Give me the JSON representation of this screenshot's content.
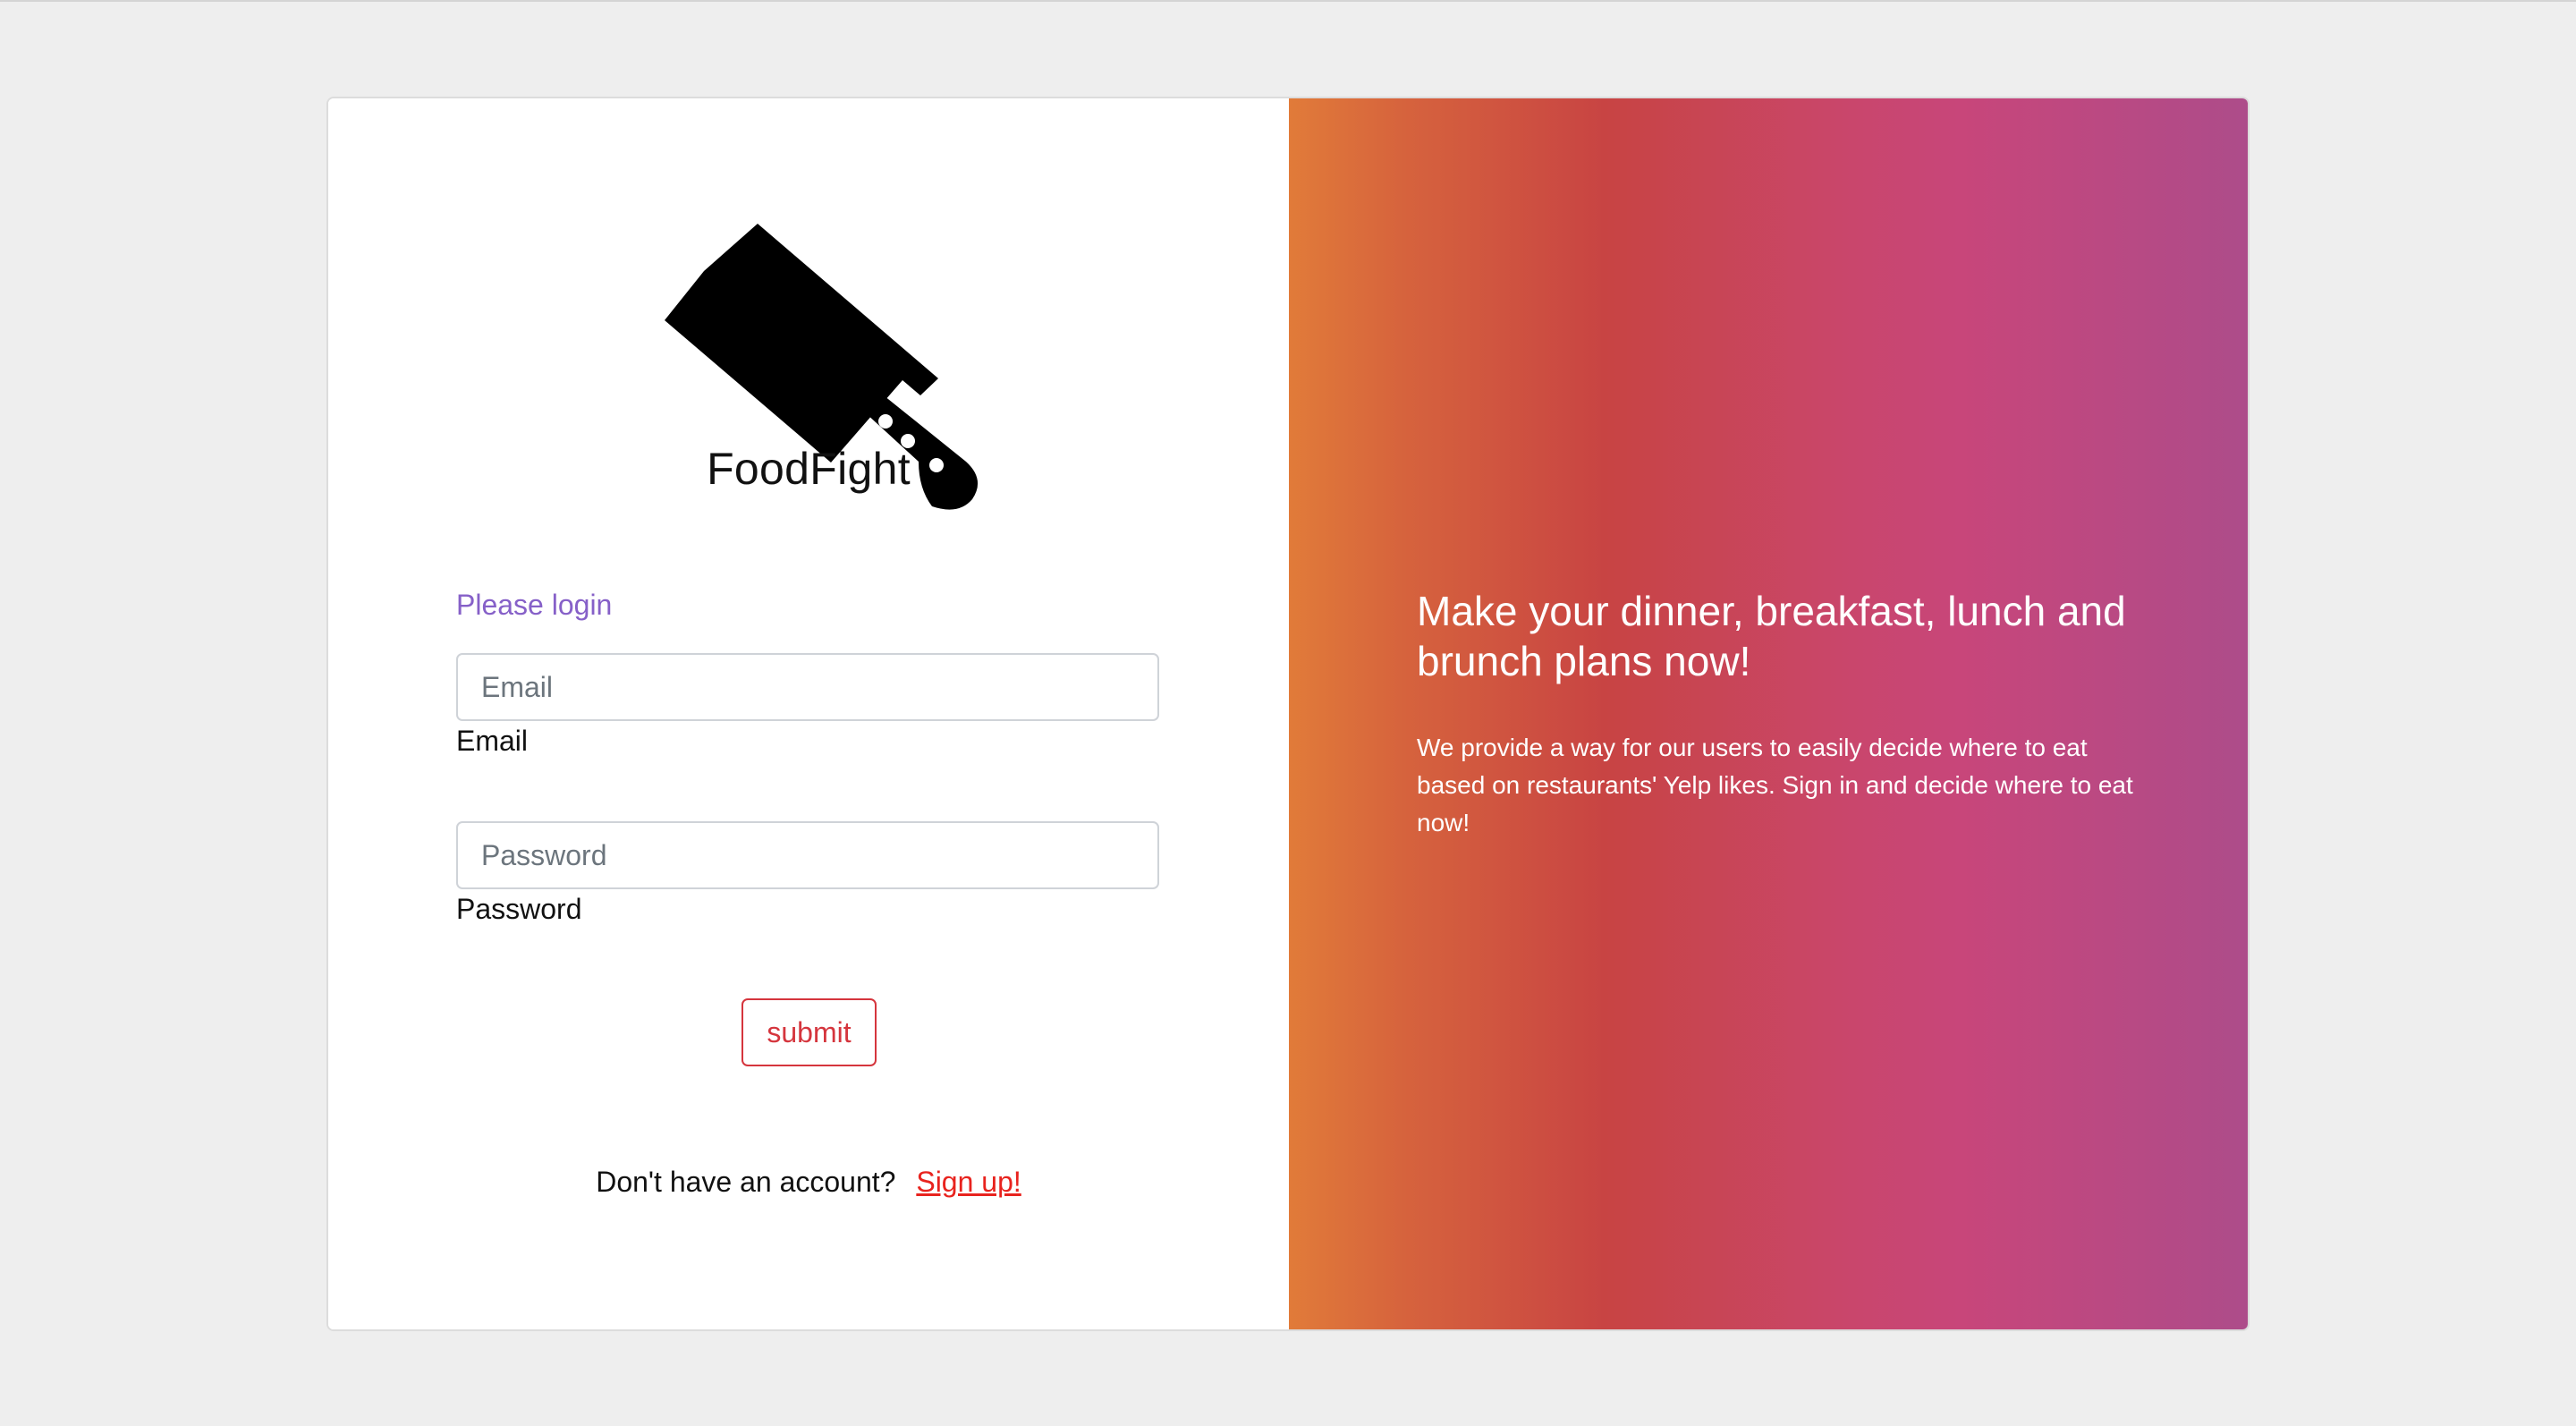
{
  "brand": {
    "name": "FoodFight",
    "logo_icon": "cleaver-knife-icon"
  },
  "login": {
    "heading": "Please login",
    "email": {
      "placeholder": "Email",
      "value": "",
      "label": "Email"
    },
    "password": {
      "placeholder": "Password",
      "value": "",
      "label": "Password"
    },
    "submit_label": "submit",
    "signup_prompt": "Don't have an account?",
    "signup_link": "Sign up!"
  },
  "promo": {
    "title": "Make your dinner, breakfast, lunch and brunch plans now!",
    "text": "We provide a way for our users to easily decide where to eat based on restaurants' Yelp likes. Sign in and decide where to eat now!"
  },
  "colors": {
    "page_background": "#eeeeee",
    "heading_purple": "#8660c8",
    "submit_red": "#d5353d",
    "link_red": "#e8231e",
    "gradient_start": "#e17b39",
    "gradient_mid": "#c84443",
    "gradient_pink": "#c8467a",
    "gradient_end": "#ad4c8a"
  }
}
